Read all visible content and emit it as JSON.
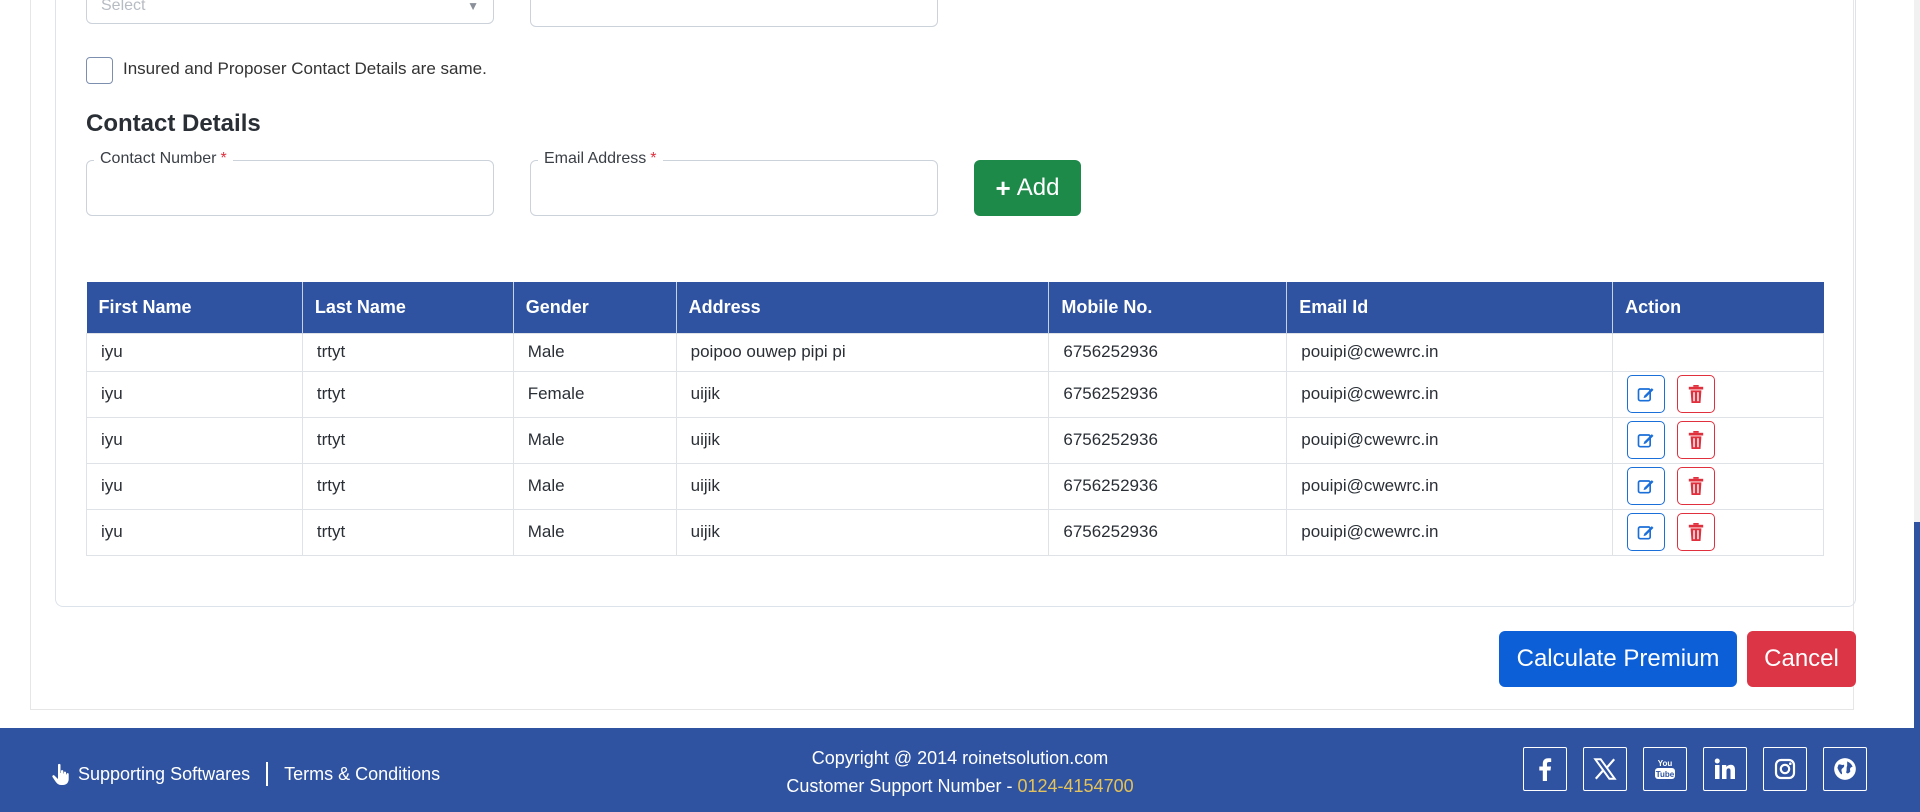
{
  "form": {
    "previous_select_placeholder": "Select",
    "same_contact_checkbox_label": "Insured and Proposer Contact Details are same.",
    "contact_section_title": "Contact Details",
    "contact_number_label": "Contact Number",
    "email_address_label": "Email Address",
    "required_marker": "*",
    "add_button_label": "Add"
  },
  "table": {
    "headers": [
      "First Name",
      "Last Name",
      "Gender",
      "Address",
      "Mobile No.",
      "Email Id",
      "Action"
    ],
    "rows": [
      {
        "first": "iyu",
        "last": "trtyt",
        "gender": "Male",
        "address": "poipoo ouwep pipi pi",
        "mobile": "6756252936",
        "email": "pouipi@cwewrc.in"
      },
      {
        "first": "iyu",
        "last": "trtyt",
        "gender": "Female",
        "address": "uijik",
        "mobile": "6756252936",
        "email": "pouipi@cwewrc.in"
      },
      {
        "first": "iyu",
        "last": "trtyt",
        "gender": "Male",
        "address": "uijik",
        "mobile": "6756252936",
        "email": "pouipi@cwewrc.in"
      },
      {
        "first": "iyu",
        "last": "trtyt",
        "gender": "Male",
        "address": "uijik",
        "mobile": "6756252936",
        "email": "pouipi@cwewrc.in"
      },
      {
        "first": "iyu",
        "last": "trtyt",
        "gender": "Male",
        "address": "uijik",
        "mobile": "6756252936",
        "email": "pouipi@cwewrc.in"
      }
    ]
  },
  "actions": {
    "calculate_label": "Calculate Premium",
    "cancel_label": "Cancel"
  },
  "footer": {
    "supporting_softwares": "Supporting Softwares",
    "terms": "Terms & Conditions",
    "copyright": "Copyright @ 2014 roinetsolution.com",
    "support_prefix": "Customer Support Number -",
    "support_number": "0124-4154700",
    "social_icons": [
      "facebook-icon",
      "x-twitter-icon",
      "youtube-icon",
      "linkedin-icon",
      "instagram-icon",
      "globe-icon"
    ]
  },
  "colors": {
    "brand_blue": "#2f53a0",
    "add_green": "#1e8a4a",
    "primary_blue": "#0d5fd8",
    "danger_red": "#dc3545",
    "support_number_gold": "#e3c25b"
  }
}
